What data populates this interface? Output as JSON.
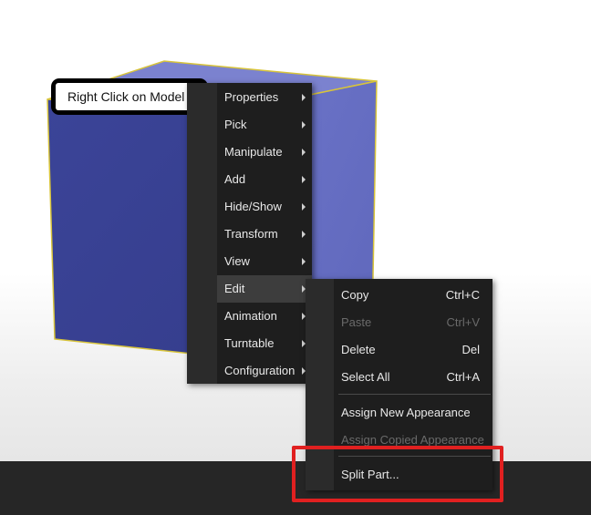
{
  "callout": {
    "text": "Right Click on Model"
  },
  "context_menu": {
    "items": [
      {
        "label": "Properties",
        "has_submenu": true
      },
      {
        "label": "Pick",
        "has_submenu": true
      },
      {
        "label": "Manipulate",
        "has_submenu": true
      },
      {
        "label": "Add",
        "has_submenu": true
      },
      {
        "label": "Hide/Show",
        "has_submenu": true
      },
      {
        "label": "Transform",
        "has_submenu": true
      },
      {
        "label": "View",
        "has_submenu": true
      },
      {
        "label": "Edit",
        "has_submenu": true,
        "active": true
      },
      {
        "label": "Animation",
        "has_submenu": true
      },
      {
        "label": "Turntable",
        "has_submenu": true
      },
      {
        "label": "Configuration",
        "has_submenu": true
      }
    ]
  },
  "edit_submenu": {
    "items": [
      {
        "label": "Copy",
        "shortcut": "Ctrl+C",
        "enabled": true
      },
      {
        "label": "Paste",
        "shortcut": "Ctrl+V",
        "enabled": false
      },
      {
        "label": "Delete",
        "shortcut": "Del",
        "enabled": true
      },
      {
        "label": "Select All",
        "shortcut": "Ctrl+A",
        "enabled": true
      },
      {
        "label": "Assign New Appearance",
        "shortcut": "",
        "enabled": true
      },
      {
        "label": "Assign Copied Appearance",
        "shortcut": "",
        "enabled": false
      },
      {
        "label": "Split Part...",
        "shortcut": "",
        "enabled": true
      }
    ]
  },
  "colors": {
    "model_front": "#3a4396",
    "model_side": "#6b73c8",
    "model_top": "#7c83d0",
    "model_edge": "#d8c43a",
    "menu_bg": "#1e1e1e",
    "highlight": "#e02020",
    "bottom_bar": "#262626"
  }
}
